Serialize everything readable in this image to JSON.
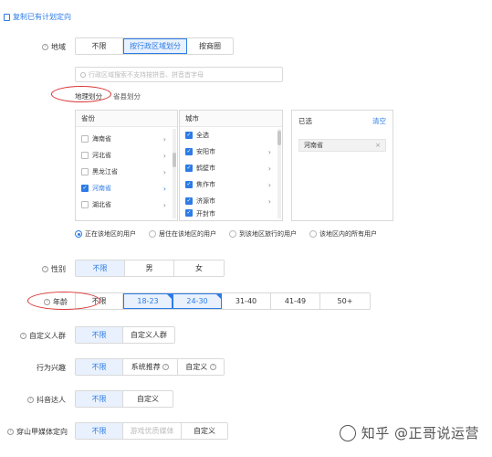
{
  "copy_plan_link": "复制已有计划定向",
  "region": {
    "label": "地域",
    "options": [
      "不限",
      "按行政区域划分",
      "按商圈"
    ],
    "search_placeholder": "行政区域搜索不支持按拼音、拼音首字母",
    "tabs": [
      "地理划分",
      "省县划分"
    ],
    "province_header": "省份",
    "city_header": "城市",
    "provinces": [
      "海南省",
      "河北省",
      "黑龙江省",
      "河南省",
      "湖北省"
    ],
    "cities": [
      "全选",
      "安阳市",
      "鹤壁市",
      "焦作市",
      "济源市",
      "开封市"
    ],
    "selected_title": "已选",
    "clear_label": "清空",
    "selected_tags": [
      "河南省"
    ],
    "location_modes": [
      "正在该地区的用户",
      "居住在该地区的用户",
      "到该地区旅行的用户",
      "该地区内的所有用户"
    ]
  },
  "gender": {
    "label": "性别",
    "options": [
      "不限",
      "男",
      "女"
    ]
  },
  "age": {
    "label": "年龄",
    "options": [
      "不限",
      "18-23",
      "24-30",
      "31-40",
      "41-49",
      "50+"
    ]
  },
  "custom_audience": {
    "label": "自定义人群",
    "options": [
      "不限",
      "自定义人群"
    ]
  },
  "behavior_interest": {
    "label": "行为兴趣",
    "options": [
      "不限",
      "系统推荐",
      "自定义"
    ]
  },
  "douyin_influencer": {
    "label": "抖音达人",
    "options": [
      "不限",
      "自定义"
    ]
  },
  "media_targeting": {
    "label": "穿山甲媒体定向",
    "options": [
      "不限",
      "游戏优质媒体",
      "自定义"
    ]
  },
  "watermark": "知乎 @正哥说运营",
  "colors": {
    "accent": "#2d7be5",
    "annotation": "#d93636"
  }
}
